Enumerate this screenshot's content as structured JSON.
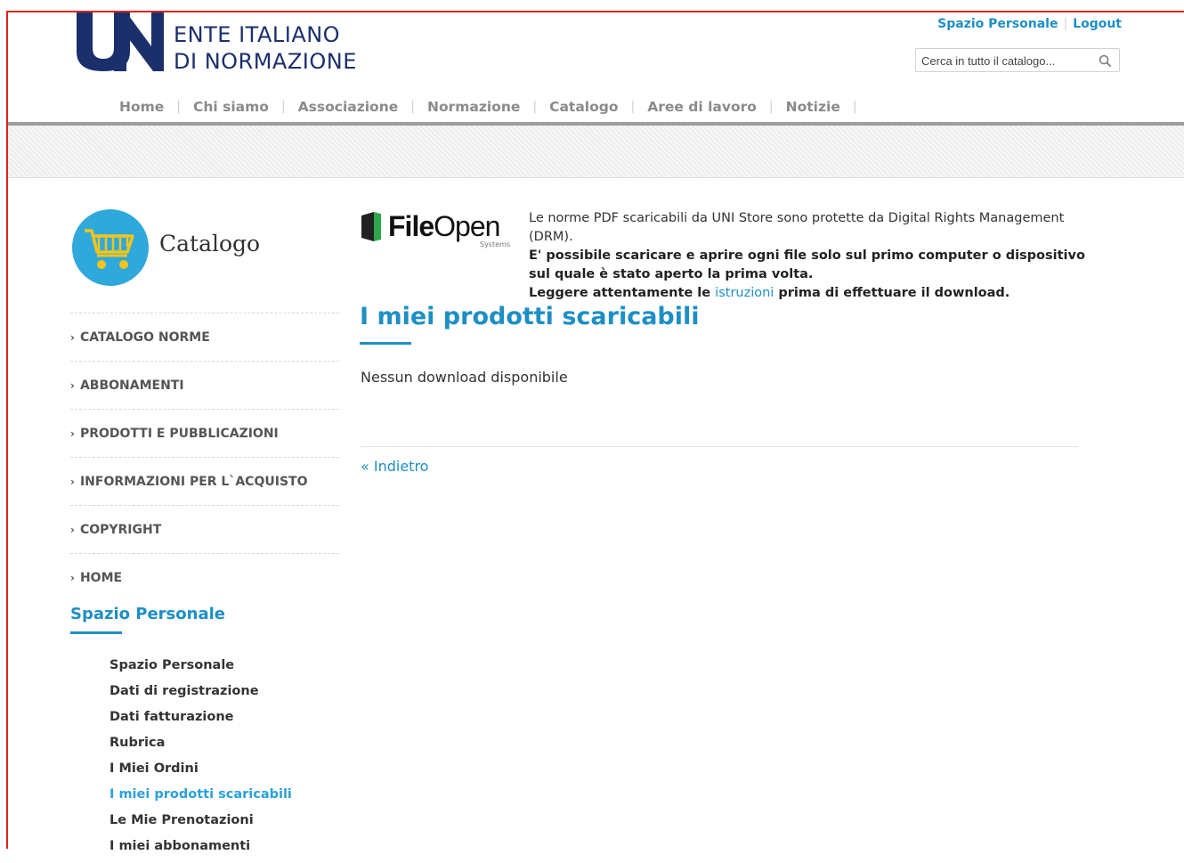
{
  "header": {
    "logo_line1": "ENTE ITALIANO",
    "logo_line2": "DI NORMAZIONE",
    "top_links": [
      "Spazio Personale",
      "Logout"
    ],
    "search": {
      "placeholder": "Cerca in tutto il catalogo...",
      "icon": "search-icon"
    }
  },
  "nav": {
    "items": [
      "Home",
      "Chi siamo",
      "Associazione",
      "Normazione",
      "Catalogo",
      "Aree di lavoro",
      "Notizie"
    ],
    "separator": "|"
  },
  "sidebar": {
    "catalog_title": "Catalogo",
    "catalog_icon": "shopping-cart-icon",
    "menu": [
      "CATALOGO NORME",
      "ABBONAMENTI",
      "PRODOTTI E PUBBLICAZIONI",
      "INFORMAZIONI PER L`ACQUISTO",
      "COPYRIGHT",
      "HOME"
    ],
    "menu_chevron": "›",
    "personal_title": "Spazio Personale",
    "personal_items": [
      "Spazio Personale",
      "Dati di registrazione",
      "Dati fatturazione",
      "Rubrica",
      "I Miei Ordini",
      "I miei prodotti scaricabili",
      "Le Mie Prenotazioni",
      "I miei abbonamenti"
    ],
    "personal_active": "I miei prodotti scaricabili"
  },
  "main": {
    "fileopen": {
      "bold": "File",
      "thin": "Open",
      "sub": "Systems"
    },
    "drm_line1": "Le norme PDF scaricabili da UNI Store sono protette da Digital Rights Management (DRM).",
    "drm_line2": "E' possibile scaricare e aprire ogni file solo sul primo computer o dispositivo sul quale è stato aperto la prima volta.",
    "drm_line3_pre": "Leggere attentamente le",
    "drm_link": "istruzioni",
    "drm_line3_post": "prima di effettuare il download.",
    "title": "I miei prodotti scaricabili",
    "empty_message": "Nessun download disponibile",
    "back_link": "« Indietro"
  },
  "colors": {
    "accent": "#1e8fc4",
    "logo_blue": "#1b2f6b",
    "frame": "#e02020",
    "catalog_circle": "#2fa8dc"
  }
}
